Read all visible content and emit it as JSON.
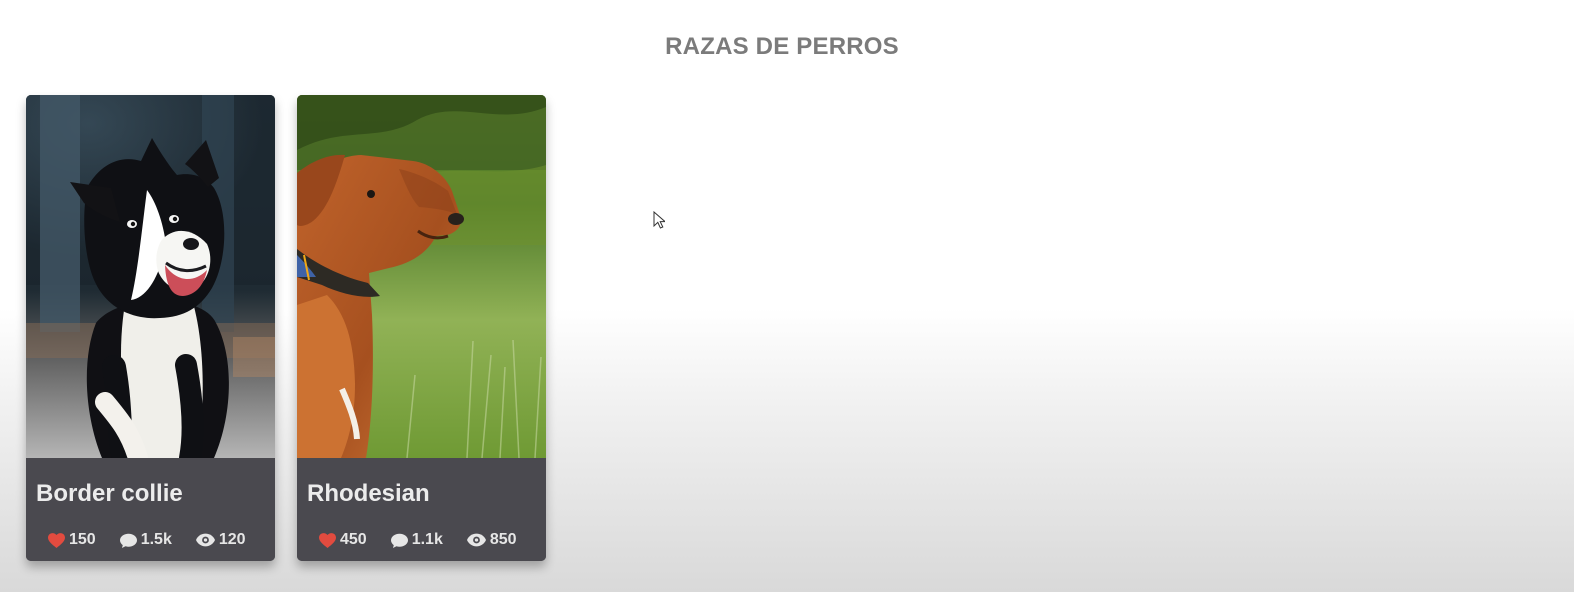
{
  "page": {
    "title": "RAZAS DE PERROS"
  },
  "cards": [
    {
      "title": "Border collie",
      "image_subject": "border-collie",
      "stats": {
        "likes": "150",
        "comments": "1.5k",
        "views": "120"
      }
    },
    {
      "title": "Rhodesian",
      "image_subject": "rhodesian-ridgeback",
      "stats": {
        "likes": "450",
        "comments": "1.1k",
        "views": "850"
      }
    }
  ],
  "colors": {
    "card_background": "#4a494f",
    "title_gray": "#7b7b7b",
    "heart_red": "#e24b3f",
    "icon_light": "#e6e6e6"
  },
  "icons": {
    "likes": "heart-icon",
    "comments": "comment-icon",
    "views": "eye-icon"
  }
}
